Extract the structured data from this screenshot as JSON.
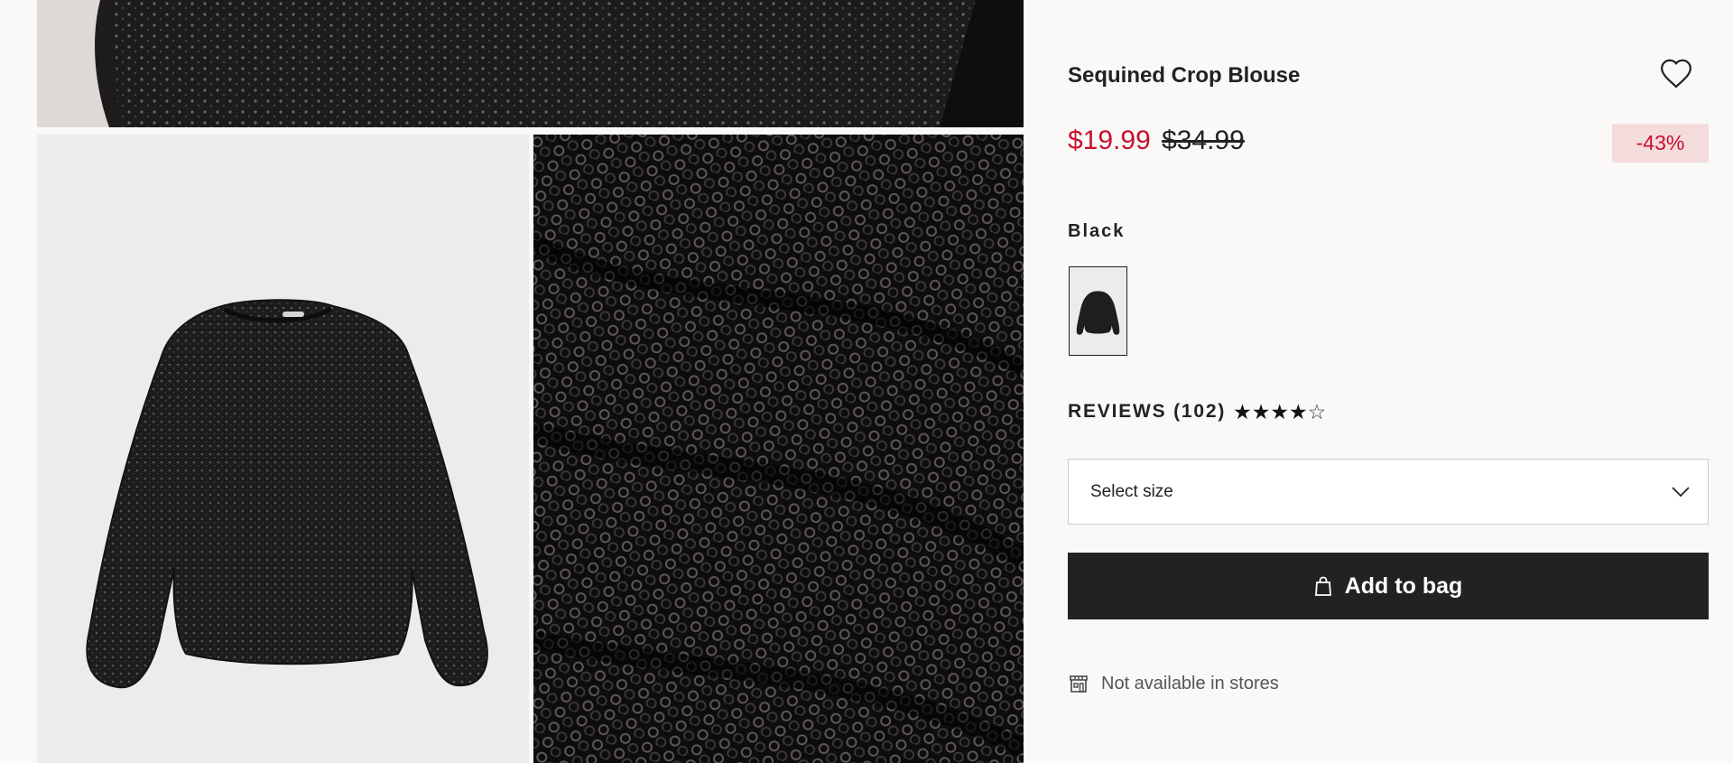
{
  "product": {
    "title": "Sequined Crop Blouse",
    "price_sale": "$19.99",
    "price_original": "$34.99",
    "discount": "-43%",
    "color_name": "Black",
    "reviews_label": "REVIEWS (102)",
    "rating": 4,
    "rating_max": 5,
    "size_placeholder": "Select size",
    "add_to_bag": "Add to bag",
    "store_availability": "Not available in stores"
  },
  "colors": {
    "sale": "#c8102e",
    "discount_bg": "#f5dcdc",
    "button_bg": "#222222",
    "page_bg": "#faf9f8"
  },
  "icons": {
    "favorite": "heart-outline-icon",
    "dropdown": "chevron-down-icon",
    "bag": "shopping-bag-icon",
    "store": "store-icon"
  }
}
